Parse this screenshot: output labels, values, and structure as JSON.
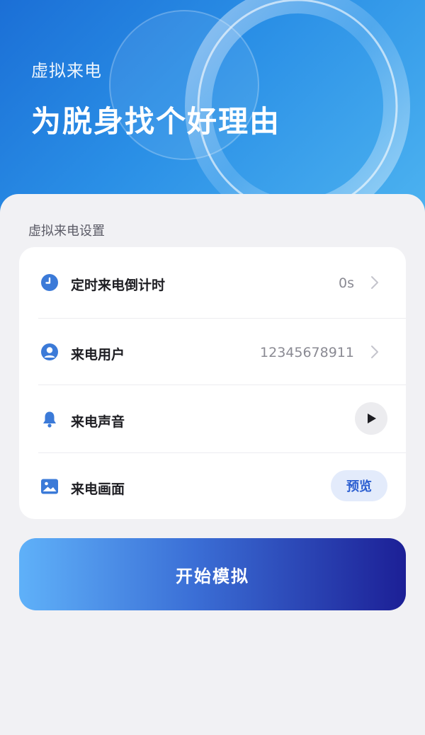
{
  "hero": {
    "subtitle": "虚拟来电",
    "title": "为脱身找个好理由"
  },
  "settings": {
    "section_title": "虚拟来电设置",
    "rows": [
      {
        "label": "定时来电倒计时",
        "value": "0s",
        "icon": "clock-icon"
      },
      {
        "label": "来电用户",
        "value": "12345678911",
        "icon": "user-icon"
      },
      {
        "label": "来电声音",
        "icon": "bell-icon",
        "action_icon": "play-icon"
      },
      {
        "label": "来电画面",
        "icon": "image-icon",
        "action_label": "预览"
      }
    ]
  },
  "start_button": {
    "label": "开始模拟"
  },
  "colors": {
    "accent": "#3b7ad8",
    "hero_bg": "#2a8fe6",
    "button_start": "#5fb1f9",
    "button_end": "#1c1f96"
  }
}
